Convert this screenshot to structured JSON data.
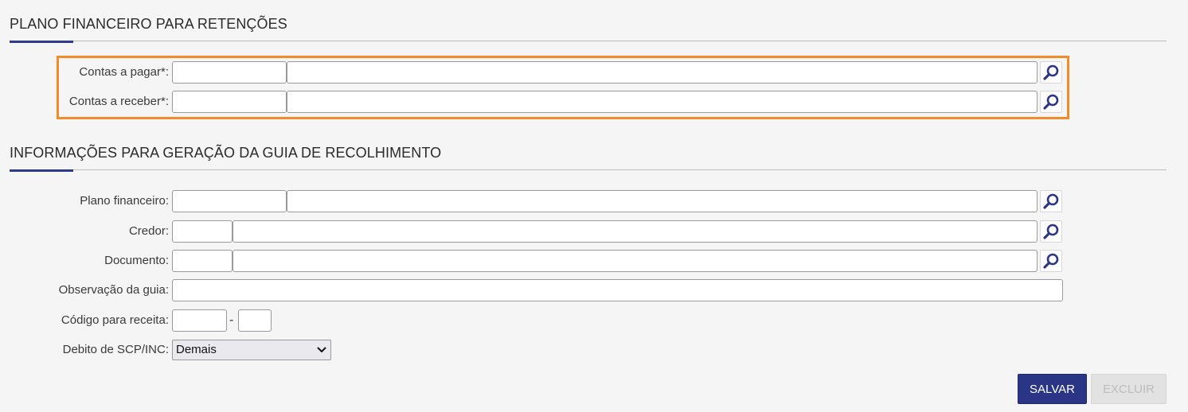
{
  "section1": {
    "title": "PLANO FINANCEIRO PARA RETENÇÕES"
  },
  "section2": {
    "title": "INFORMAÇÕES PARA GERAÇÃO DA GUIA DE RECOLHIMENTO"
  },
  "fields": {
    "contas_pagar": {
      "label": "Contas a pagar*:",
      "code": "",
      "desc": ""
    },
    "contas_receber": {
      "label": "Contas a receber*:",
      "code": "",
      "desc": ""
    },
    "plano_financeiro": {
      "label": "Plano financeiro:",
      "code": "",
      "desc": ""
    },
    "credor": {
      "label": "Credor:",
      "code": "",
      "desc": ""
    },
    "documento": {
      "label": "Documento:",
      "code": "",
      "desc": ""
    },
    "observacao": {
      "label": "Observação da guia:",
      "value": ""
    },
    "codigo_receita": {
      "label": "Código para receita:",
      "part1": "",
      "separator": "-",
      "part2": ""
    },
    "debito_scp": {
      "label": "Debito de SCP/INC:",
      "selected": "Demais"
    }
  },
  "icons": {
    "lookup": "search-icon",
    "dropdown": "chevron-down-icon"
  },
  "colors": {
    "accent": "#2e3a8c",
    "highlight": "#f28c28",
    "primary_button": "#2b3585"
  },
  "buttons": {
    "save": "SALVAR",
    "delete": "EXCLUIR"
  }
}
